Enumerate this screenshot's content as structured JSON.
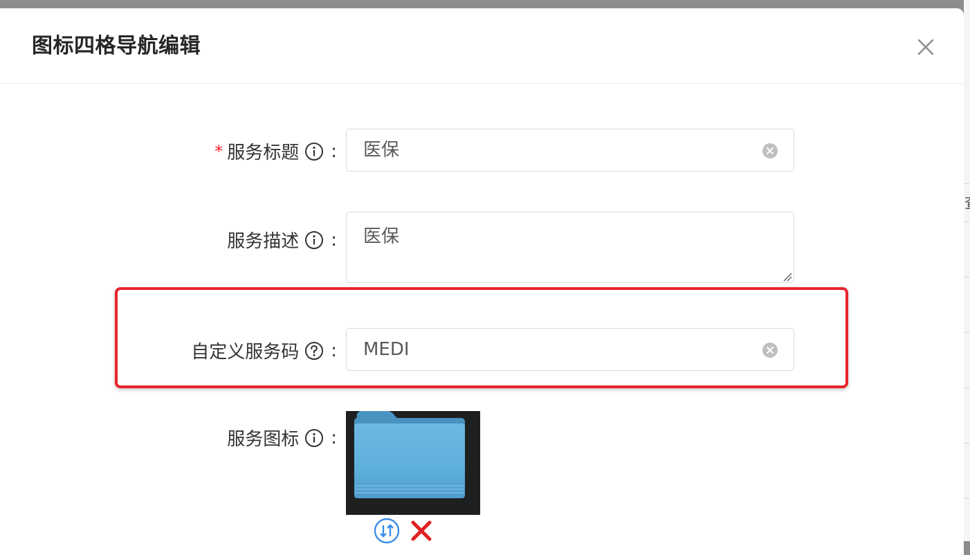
{
  "dialog": {
    "title": "图标四格导航编辑"
  },
  "form": {
    "service_title": {
      "label": "服务标题",
      "required_mark": "*",
      "colon": ":",
      "value": "医保"
    },
    "service_desc": {
      "label": "服务描述",
      "colon": ":",
      "value": "医保"
    },
    "custom_code": {
      "label": "自定义服务码",
      "colon": ":",
      "value": "MEDI"
    },
    "service_icon": {
      "label": "服务图标",
      "colon": ":",
      "image": "folder-icon"
    }
  },
  "background_page": {
    "partial_text": "查"
  },
  "colors": {
    "highlight": "#e8232b",
    "required": "#f5222d",
    "swap_icon": "#3a8ee6",
    "delete_icon": "#e02020"
  }
}
